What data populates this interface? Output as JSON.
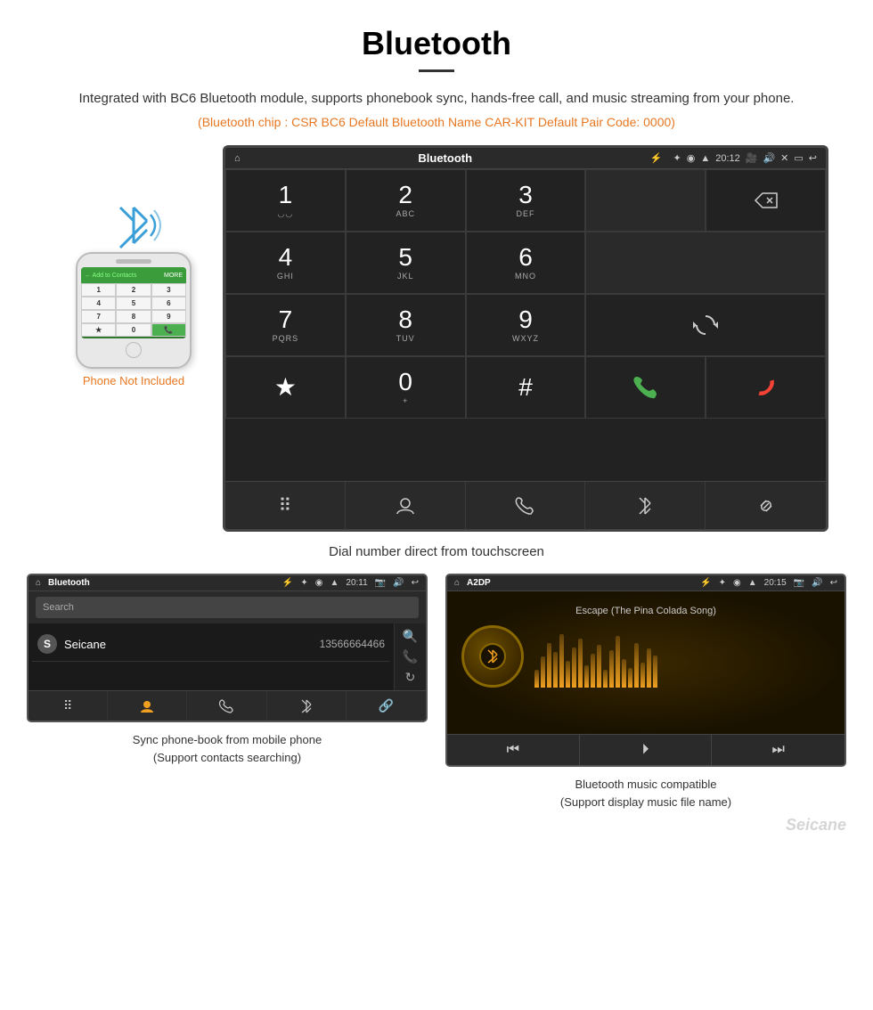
{
  "header": {
    "title": "Bluetooth",
    "description": "Integrated with BC6 Bluetooth module, supports phonebook sync, hands-free call, and music streaming from your phone.",
    "orange_info": "(Bluetooth chip : CSR BC6    Default Bluetooth Name CAR-KIT    Default Pair Code: 0000)"
  },
  "large_screen": {
    "statusbar": {
      "home_icon": "⌂",
      "title": "Bluetooth",
      "usb_icon": "⚡",
      "bluetooth_icon": "✦",
      "location_icon": "◉",
      "signal_icon": "▲",
      "time": "20:12",
      "camera_icon": "📷",
      "volume_icon": "🔊",
      "close_icon": "✕",
      "back_icon": "↩"
    },
    "dialer": {
      "keys": [
        {
          "num": "1",
          "sub": "◡◡"
        },
        {
          "num": "2",
          "sub": "ABC"
        },
        {
          "num": "3",
          "sub": "DEF"
        },
        {
          "num": "4",
          "sub": "GHI"
        },
        {
          "num": "5",
          "sub": "JKL"
        },
        {
          "num": "6",
          "sub": "MNO"
        },
        {
          "num": "7",
          "sub": "PQRS"
        },
        {
          "num": "8",
          "sub": "TUV"
        },
        {
          "num": "9",
          "sub": "WXYZ"
        },
        {
          "num": "★",
          "sub": ""
        },
        {
          "num": "0",
          "sub": "+"
        },
        {
          "num": "#",
          "sub": ""
        }
      ]
    },
    "nav_items": [
      "⠿",
      "👤",
      "📞",
      "✦",
      "🔗"
    ]
  },
  "caption_main": "Dial number direct from touchscreen",
  "phone_mockup": {
    "not_included": "Phone Not Included"
  },
  "bottom_left": {
    "statusbar_title": "Bluetooth",
    "statusbar_time": "20:11",
    "search_placeholder": "Search",
    "contact_letter": "S",
    "contact_name": "Seicane",
    "contact_number": "13566664466",
    "nav_items": [
      "⠿",
      "👤",
      "📞",
      "✦",
      "🔗"
    ],
    "caption": "Sync phone-book from mobile phone\n(Support contacts searching)"
  },
  "bottom_right": {
    "statusbar_title": "A2DP",
    "statusbar_time": "20:15",
    "song_title": "Escape (The Pina Colada Song)",
    "controls": [
      "⏮",
      "⏵⏸",
      "⏭"
    ],
    "caption": "Bluetooth music compatible\n(Support display music file name)"
  },
  "watermark": "Seicane"
}
